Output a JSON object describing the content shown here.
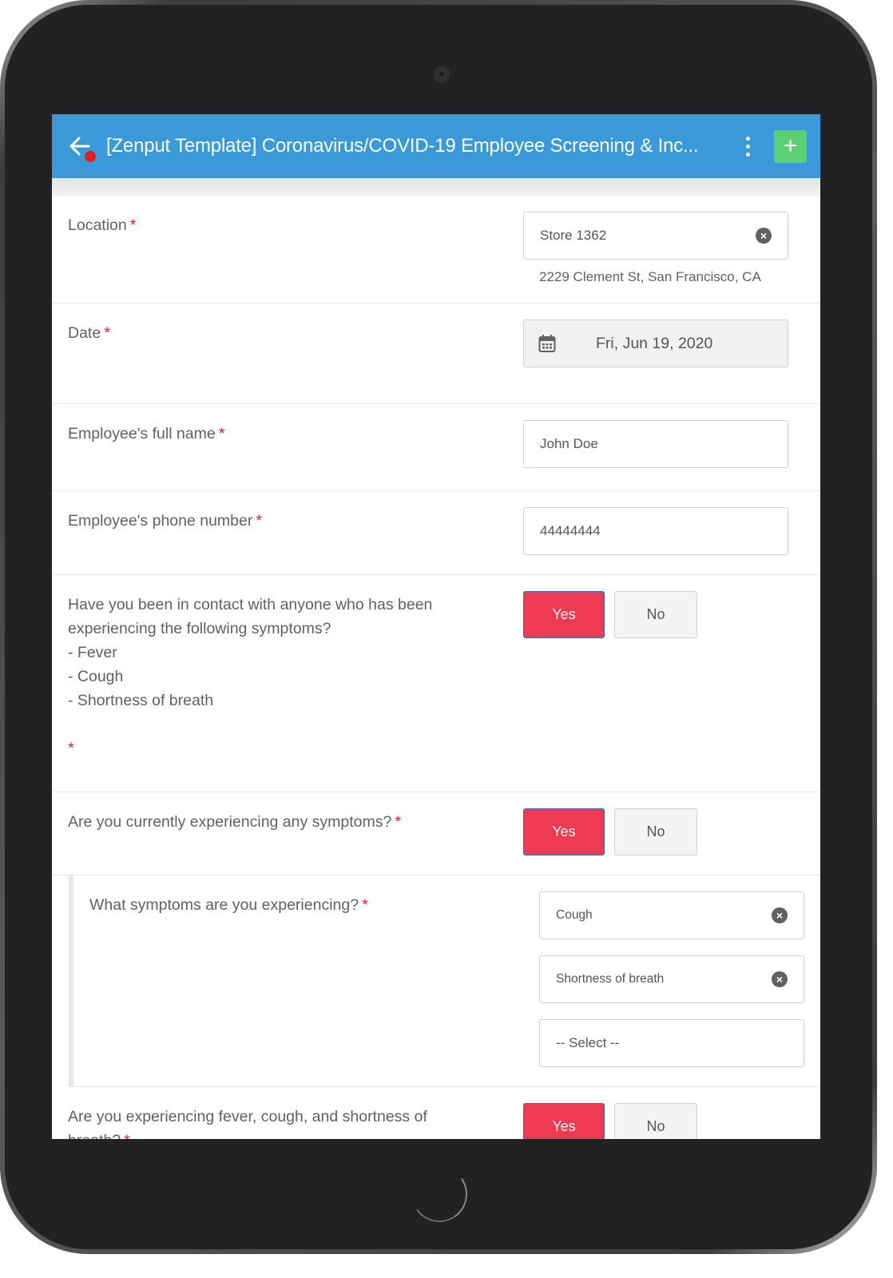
{
  "header": {
    "title": "[Zenput Template] Coronavirus/COVID-19 Employee Screening & Inc...",
    "back_icon": "arrow-left-icon",
    "menu_icon": "more-vertical-icon",
    "add_label": "+"
  },
  "colors": {
    "appbar": "#3a9ad9",
    "add_button": "#5ccf73",
    "yes_selected": "#ee3a53",
    "required_asterisk": "#e0223a"
  },
  "form": {
    "required_mark": "*",
    "location": {
      "label": "Location",
      "value": "Store 1362",
      "address": "2229 Clement St,  San Francisco, CA"
    },
    "date": {
      "label": "Date",
      "value": "Fri, Jun 19, 2020"
    },
    "full_name": {
      "label": "Employee's full name",
      "value": "John Doe"
    },
    "phone": {
      "label": "Employee's phone number",
      "value": "44444444"
    },
    "contact_question": {
      "lines": [
        "Have you been in contact with anyone who has been",
        "experiencing the following symptoms?",
        "- Fever",
        "- Cough",
        "- Shortness of breath"
      ],
      "yes_label": "Yes",
      "no_label": "No",
      "selected": "Yes"
    },
    "current_symptoms": {
      "label": "Are you currently experiencing any symptoms?",
      "yes_label": "Yes",
      "no_label": "No",
      "selected": "Yes"
    },
    "which_symptoms": {
      "label": "What symptoms are you experiencing?",
      "selected": [
        "Cough",
        "Shortness of breath"
      ],
      "placeholder": "-- Select --"
    },
    "all_symptoms": {
      "label_line1": "Are you experiencing fever, cough, and shortness of",
      "label_line2": "breath?",
      "yes_label": "Yes",
      "no_label": "No",
      "selected": "Yes"
    }
  }
}
